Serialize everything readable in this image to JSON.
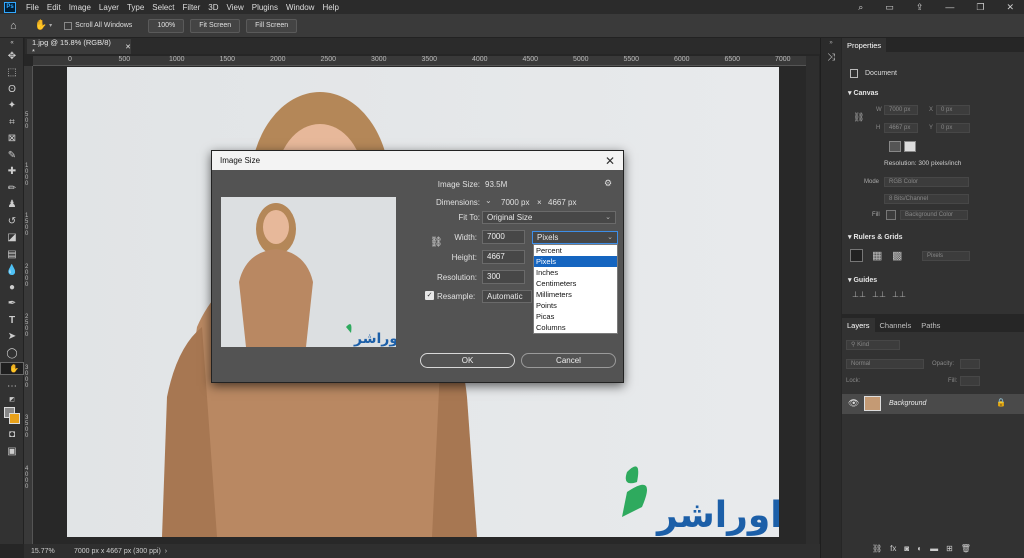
{
  "menubar": {
    "app_icon": "Ps",
    "items": [
      "File",
      "Edit",
      "Image",
      "Layer",
      "Type",
      "Select",
      "Filter",
      "3D",
      "View",
      "Plugins",
      "Window",
      "Help"
    ]
  },
  "options": {
    "scroll_all": "Scroll All Windows",
    "btn_zoom": "100%",
    "btn_fit": "Fit Screen",
    "btn_fill": "Fill Screen"
  },
  "doc": {
    "tab_title": "1.jpg @ 15.8% (RGB/8) *"
  },
  "ruler": {
    "h_labels": [
      "0",
      "500",
      "1000",
      "1500",
      "2000",
      "2500",
      "3000",
      "3500",
      "4000",
      "4500",
      "5000",
      "5500",
      "6000",
      "6500",
      "7000"
    ],
    "v_labels": [
      "5 0 0",
      "1 0 0 0",
      "1 5 0 0",
      "2 0 0 0",
      "2 5 0 0",
      "3 0 0 0",
      "3 5 0 0",
      "4 0 0 0"
    ]
  },
  "status": {
    "zoom": "15.77%",
    "info": "7000 px x 4667 px (300 ppi)"
  },
  "properties": {
    "tabs": [
      "Properties"
    ],
    "doc_label": "Document",
    "canvas_title": "Canvas",
    "w_label": "W",
    "w_value": "7000 px",
    "x_label": "X",
    "x_value": "0 px",
    "h_label": "H",
    "h_value": "4667 px",
    "y_label": "Y",
    "y_value": "0 px",
    "resolution": "Resolution: 300 pixels/inch",
    "mode_label": "Mode",
    "mode_value": "RGB Color",
    "bit_value": "8 Bits/Channel",
    "fill_label": "Fill",
    "fill_value": "Background Color",
    "rulers_title": "Rulers & Grids",
    "units_value": "Pixels",
    "guides_title": "Guides"
  },
  "layers": {
    "tabs": [
      "Layers",
      "Channels",
      "Paths"
    ],
    "kind": "Kind",
    "blend": "Normal",
    "opacity_label": "Opacity:",
    "lock_label": "Lock:",
    "fill_label": "Fill:",
    "layer_name": "Background"
  },
  "dialog": {
    "title": "Image Size",
    "size_label": "Image Size:",
    "size_value": "93.5M",
    "dim_label": "Dimensions:",
    "dim_w": "7000 px",
    "dim_x": "×",
    "dim_h": "4667 px",
    "fit_label": "Fit To:",
    "fit_value": "Original Size",
    "width_label": "Width:",
    "width_value": "7000",
    "width_unit": "Pixels",
    "height_label": "Height:",
    "height_value": "4667",
    "res_label": "Resolution:",
    "res_value": "300",
    "resample_label": "Resample:",
    "resample_value": "Automatic",
    "ok": "OK",
    "cancel": "Cancel",
    "unit_options": [
      "Percent",
      "Pixels",
      "Inches",
      "Centimeters",
      "Millimeters",
      "Points",
      "Picas",
      "Columns"
    ],
    "unit_selected": "Pixels"
  },
  "colors": {
    "accent": "#31a8ff",
    "highlight": "#1565c0",
    "sweater": "#b98862",
    "logo_green": "#2eaa5e",
    "logo_blue": "#1c5fa8"
  }
}
